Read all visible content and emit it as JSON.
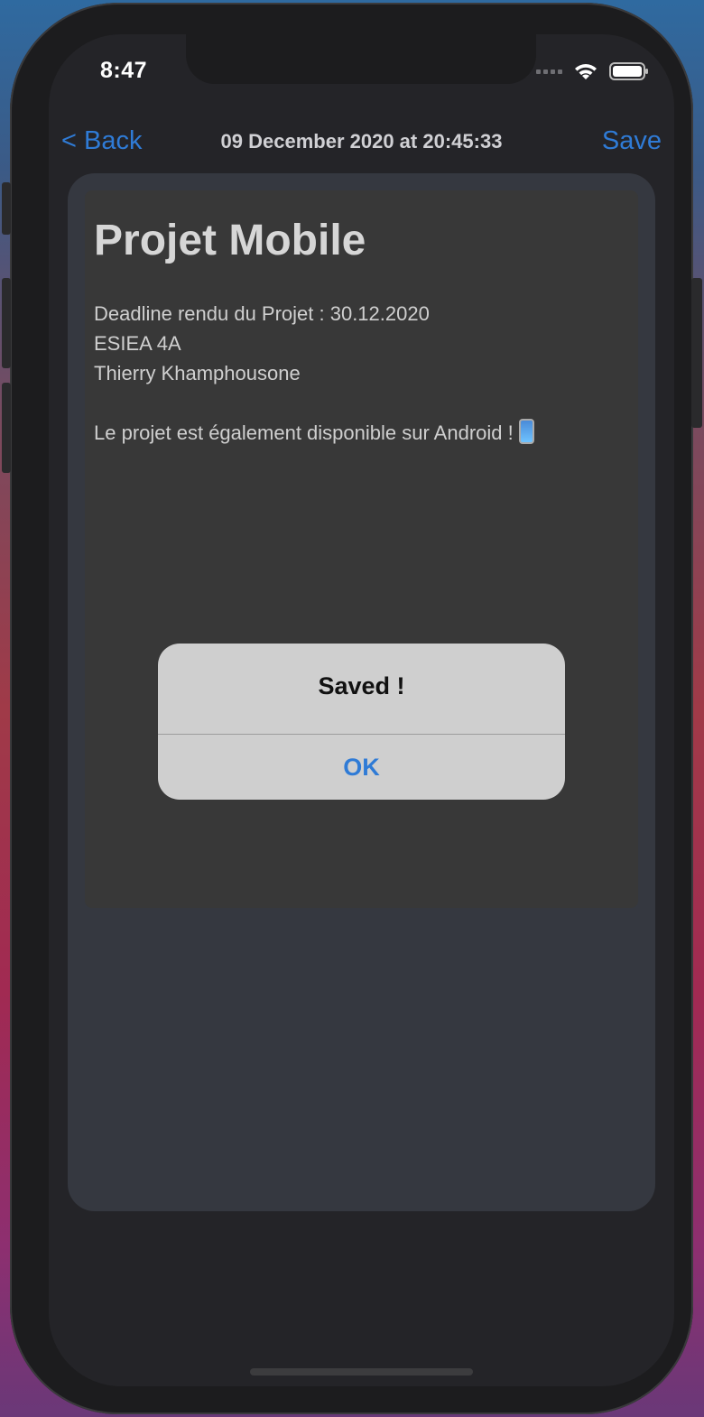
{
  "status_bar": {
    "time": "8:47",
    "wifi_icon": "wifi-icon",
    "battery_icon": "battery-icon"
  },
  "nav": {
    "back_label": "< Back",
    "title": "09 December 2020 at 20:45:33",
    "save_label": "Save"
  },
  "note": {
    "title": "Projet Mobile",
    "lines": [
      "Deadline rendu du Projet : 30.12.2020",
      "ESIEA 4A",
      "Thierry Khamphousone",
      "",
      "Le projet est également disponible sur Android !"
    ]
  },
  "alert": {
    "title": "Saved !",
    "ok_label": "OK"
  },
  "colors": {
    "accent": "#2f7bd6",
    "alert_bg": "#cfcfcf",
    "note_bg": "#383838"
  }
}
